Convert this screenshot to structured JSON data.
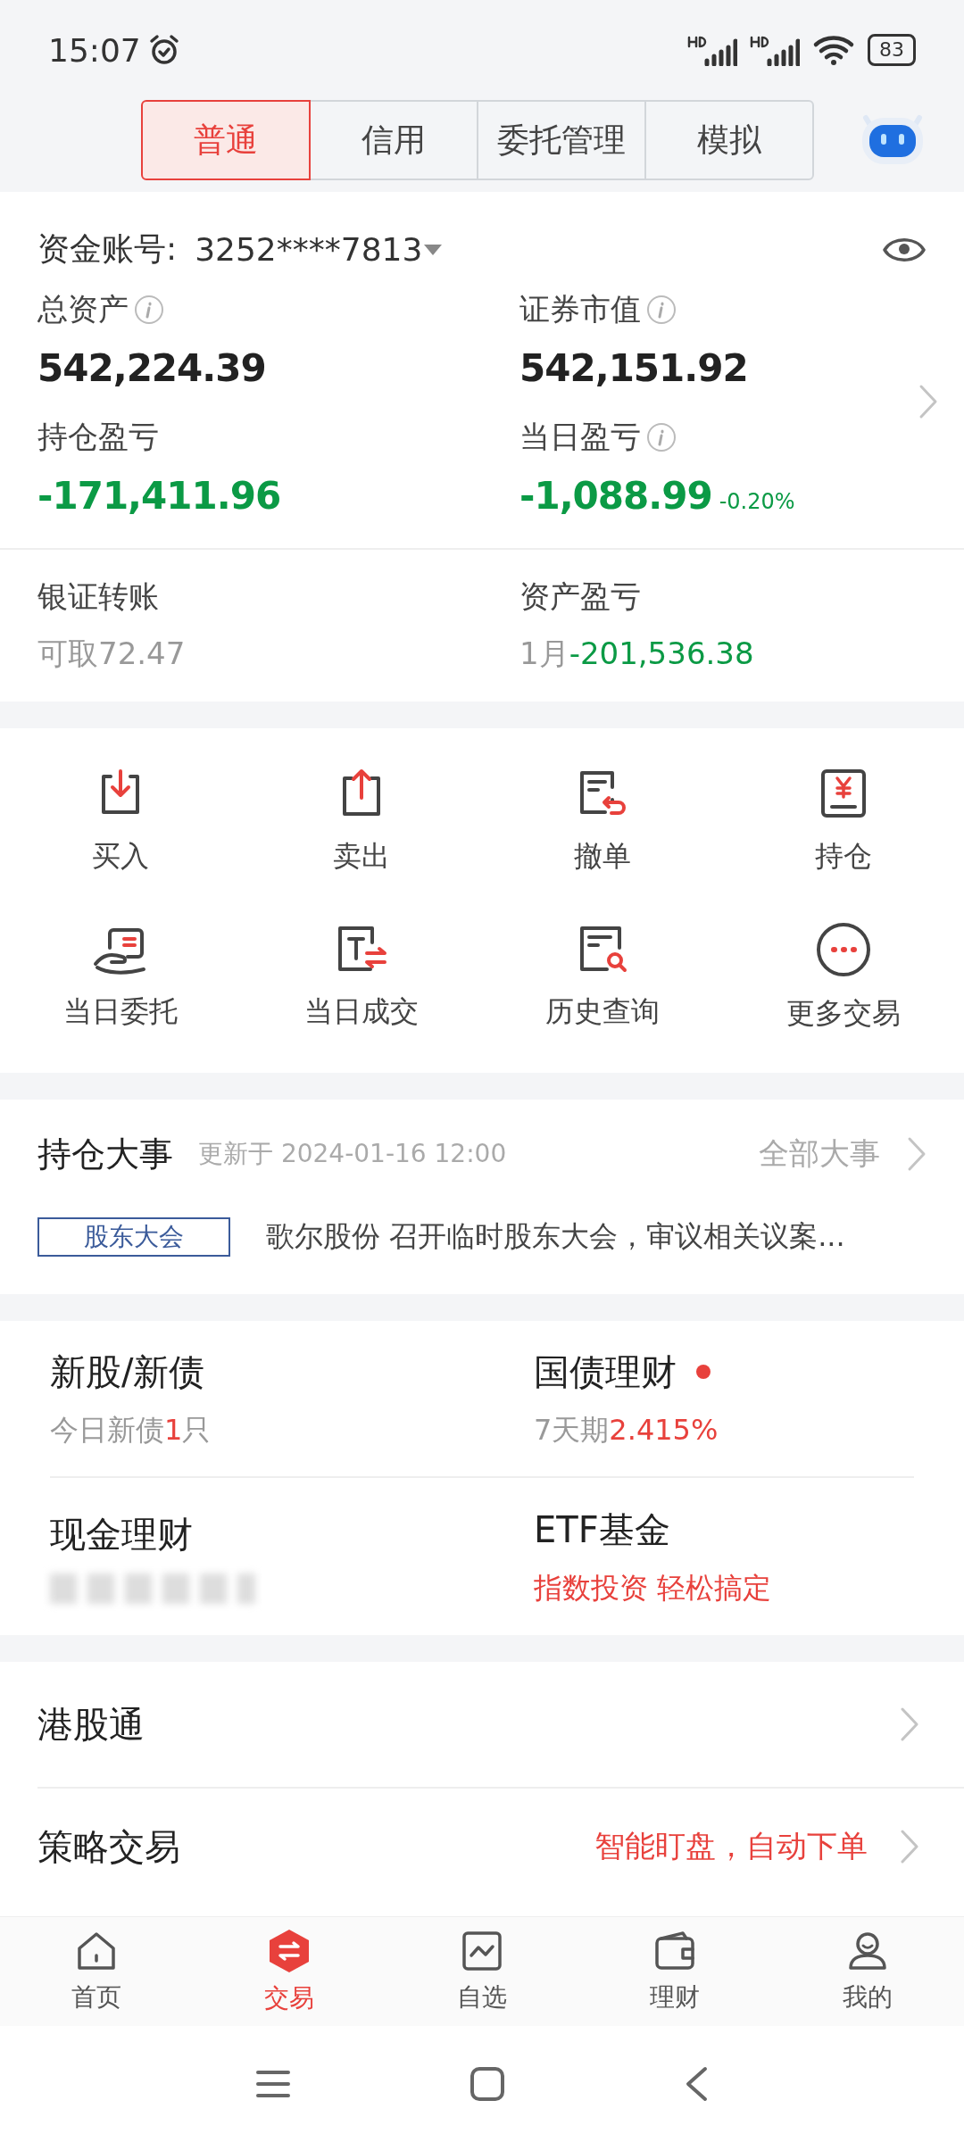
{
  "status_bar": {
    "time": "15:07",
    "battery": "83"
  },
  "account_tabs": [
    {
      "label": "普通",
      "selected": true
    },
    {
      "label": "信用",
      "selected": false
    },
    {
      "label": "委托管理",
      "selected": false
    },
    {
      "label": "模拟",
      "selected": false
    }
  ],
  "account": {
    "label": "资金账号:",
    "number": "3252****7813"
  },
  "metrics": [
    {
      "label": "总资产",
      "info": true,
      "value": "542,224.39",
      "color": "#222222"
    },
    {
      "label": "证券市值",
      "info": true,
      "value": "542,151.92",
      "color": "#222222"
    },
    {
      "label": "持仓盈亏",
      "info": false,
      "value": "-171,411.96",
      "color": "#0b9a45"
    },
    {
      "label": "当日盈亏",
      "info": true,
      "value": "-1,088.99",
      "color": "#0b9a45",
      "change": "-0.20%"
    }
  ],
  "transfers": [
    {
      "label": "银证转账",
      "note": "可取72.47"
    },
    {
      "label": "资产盈亏",
      "note": "1月",
      "value": "-201,536.38"
    }
  ],
  "actions": [
    {
      "label": "买入"
    },
    {
      "label": "卖出"
    },
    {
      "label": "撤单"
    },
    {
      "label": "持仓"
    },
    {
      "label": "当日委托"
    },
    {
      "label": "当日成交"
    },
    {
      "label": "历史查询"
    },
    {
      "label": "更多交易"
    }
  ],
  "events": {
    "title": "持仓大事",
    "updated": "更新于 2024-01-16 12:00",
    "link": "全部大事",
    "tag": "股东大会",
    "headline": "歌尔股份 召开临时股东大会，审议相关议案..."
  },
  "products": [
    {
      "title": "新股/新债",
      "dot": false,
      "blurred": false,
      "subtitle": [
        {
          "text": "今日新债",
          "color": "#999999"
        },
        {
          "text": "1",
          "color": "#e8413c"
        },
        {
          "text": "只",
          "color": "#999999"
        }
      ]
    },
    {
      "title": "国债理财",
      "dot": true,
      "blurred": false,
      "subtitle": [
        {
          "text": "7天期",
          "color": "#999999"
        },
        {
          "text": "2.415%",
          "color": "#e8413c"
        }
      ]
    },
    {
      "title": "现金理财",
      "dot": false,
      "blurred": true
    },
    {
      "title": "ETF基金",
      "dot": false,
      "blurred": false,
      "subtitle": [
        {
          "text": "指数投资 轻松搞定",
          "color": "#e8413c"
        }
      ]
    }
  ],
  "services": [
    {
      "label": "港股通"
    },
    {
      "label": "策略交易",
      "note": "智能盯盘，自动下单"
    }
  ],
  "bottom_nav": [
    {
      "label": "首页",
      "selected": false
    },
    {
      "label": "交易",
      "selected": true
    },
    {
      "label": "自选",
      "selected": false
    },
    {
      "label": "理财",
      "selected": false
    },
    {
      "label": "我的",
      "selected": false
    }
  ]
}
